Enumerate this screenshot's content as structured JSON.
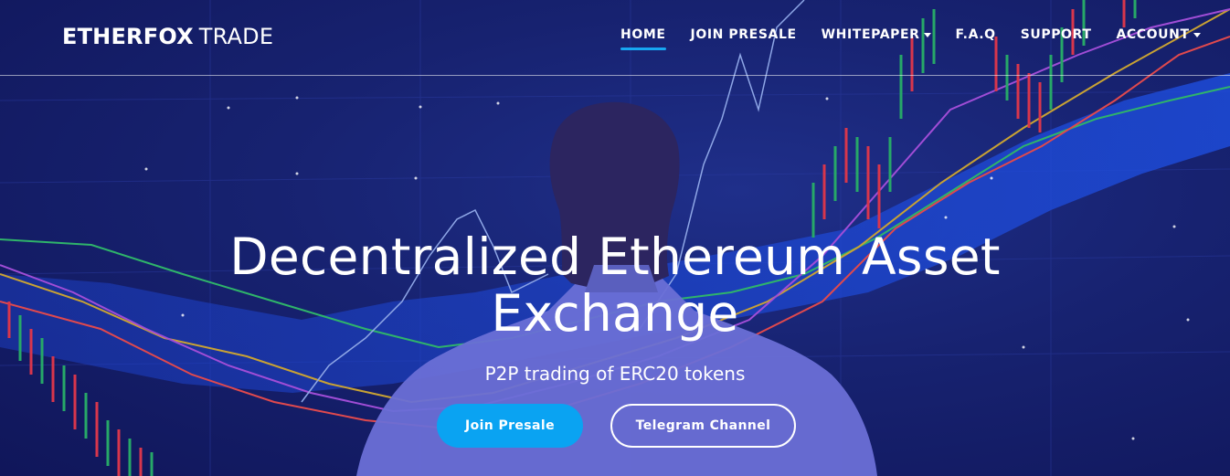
{
  "brand": {
    "bold": "ETHERFOX",
    "light": "TRADE"
  },
  "nav": {
    "items": [
      {
        "label": "HOME",
        "active": true,
        "dropdown": false
      },
      {
        "label": "JOIN PRESALE",
        "active": false,
        "dropdown": false
      },
      {
        "label": "WHITEPAPER",
        "active": false,
        "dropdown": true
      },
      {
        "label": "F.A.Q",
        "active": false,
        "dropdown": false
      },
      {
        "label": "SUPPORT",
        "active": false,
        "dropdown": false
      },
      {
        "label": "ACCOUNT",
        "active": false,
        "dropdown": true
      }
    ]
  },
  "hero": {
    "title_line1": "Decentralized Ethereum Asset",
    "title_line2": "Exchange",
    "subtitle": "P2P trading of ERC20 tokens",
    "primary_button": "Join Presale",
    "secondary_button": "Telegram Channel"
  },
  "colors": {
    "accent": "#0aa3f2",
    "background": "#172270",
    "text": "#ffffff"
  }
}
